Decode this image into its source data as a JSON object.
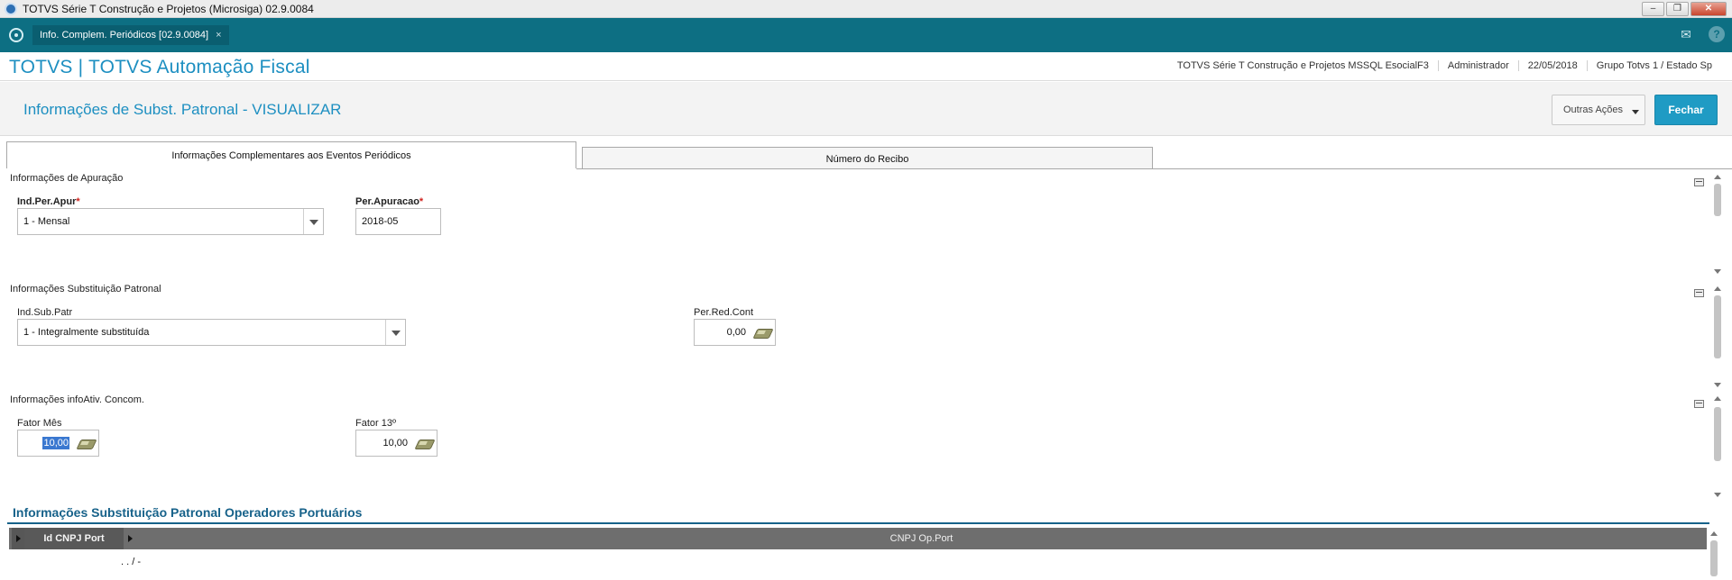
{
  "window": {
    "title": "TOTVS Série T Construção e Projetos (Microsiga) 02.9.0084",
    "minimize": "–",
    "restore": "❐",
    "close": "✕"
  },
  "tabbar": {
    "tab_label": "Info. Complem. Periódicos [02.9.0084]",
    "tab_close": "×",
    "mail_icon": "✉",
    "help_icon": "?"
  },
  "header": {
    "brand": "TOTVS | TOTVS Automação Fiscal",
    "environment": "TOTVS Série T Construção e Projetos MSSQL EsocialF3",
    "user": "Administrador",
    "date": "22/05/2018",
    "company": "Grupo Totvs 1 / Estado Sp"
  },
  "page": {
    "title": "Informações de Subst. Patronal - VISUALIZAR",
    "outras_acoes": "Outras Ações",
    "fechar": "Fechar"
  },
  "tabs": [
    {
      "label": "Informações Complementares aos Eventos Periódicos",
      "active": true
    },
    {
      "label": "Número do Recibo",
      "active": false
    }
  ],
  "sections": {
    "apuracao": {
      "title": "Informações de Apuração",
      "ind_per_apur_label": "Ind.Per.Apur",
      "ind_per_apur_value": "1 - Mensal",
      "per_apuracao_label": "Per.Apuracao",
      "per_apuracao_value": "2018-05",
      "required_mark": "*"
    },
    "subst_patronal": {
      "title": "Informações Substituição Patronal",
      "ind_sub_patr_label": "Ind.Sub.Patr",
      "ind_sub_patr_value": "1 - Integralmente substituída",
      "per_red_cont_label": "Per.Red.Cont",
      "per_red_cont_value": "0,00"
    },
    "info_ativ": {
      "title": "Informações infoAtiv. Concom.",
      "fator_mes_label": "Fator Mês",
      "fator_mes_value": "10,00",
      "fator_13_label": "Fator 13º",
      "fator_13_value": "10,00"
    }
  },
  "grid": {
    "title": "Informações Substituição Patronal Operadores Portuários",
    "columns": [
      "Id CNPJ Port",
      "CNPJ Op.Port"
    ],
    "rows": [
      {
        "id_cnpj_port": "",
        "cnpj_op_port": ".  .   /    -"
      }
    ]
  }
}
